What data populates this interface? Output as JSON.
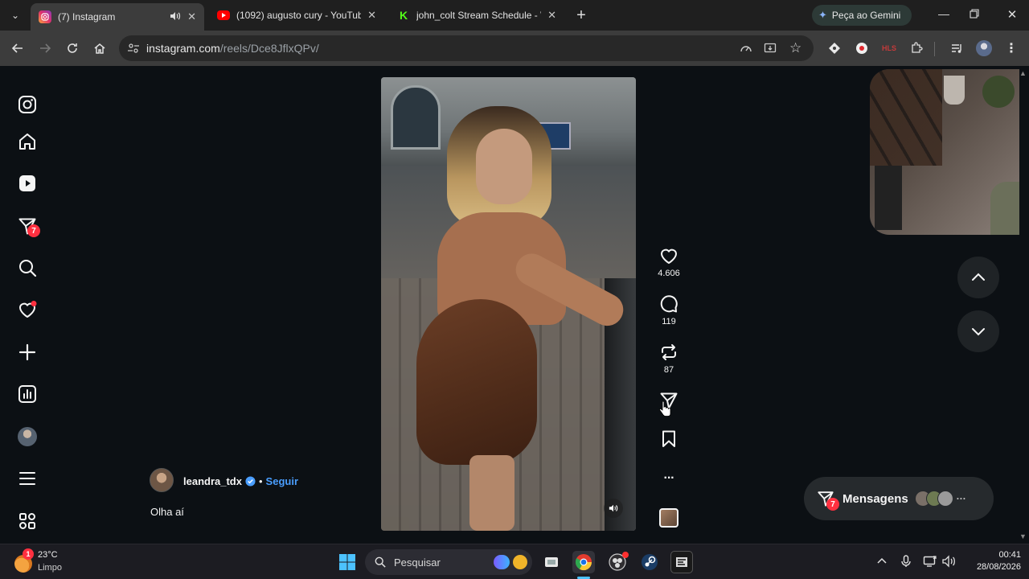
{
  "tabs": [
    {
      "title": "(7) Instagram",
      "active": true
    },
    {
      "title": "(1092) augusto cury - YouTube",
      "active": false
    },
    {
      "title": "john_colt Stream Schedule - Wa",
      "active": false
    }
  ],
  "new_tab_label": "+",
  "gemini_label": "Peça ao Gemini",
  "address": {
    "host": "instagram.com",
    "path": "/reels/Dce8JflxQPv/"
  },
  "sidebar_badge": "7",
  "reel": {
    "likes": "4.606",
    "comments": "119",
    "reposts": "87",
    "more": "···",
    "username": "leandra_tdx",
    "separator": "•",
    "follow_label": "Seguir",
    "caption": "Olha aí"
  },
  "messages": {
    "label": "Mensagens",
    "badge": "7",
    "more": "···"
  },
  "taskbar": {
    "temperature": "23°C",
    "weather": "Limpo",
    "weather_badge": "1",
    "search_placeholder": "Pesquisar",
    "time": "00:41",
    "date": "28/08/2026"
  },
  "colors": {
    "accent_blue": "#4a9eff",
    "notification_red": "#ff3040",
    "page_bg": "#0c1014"
  }
}
